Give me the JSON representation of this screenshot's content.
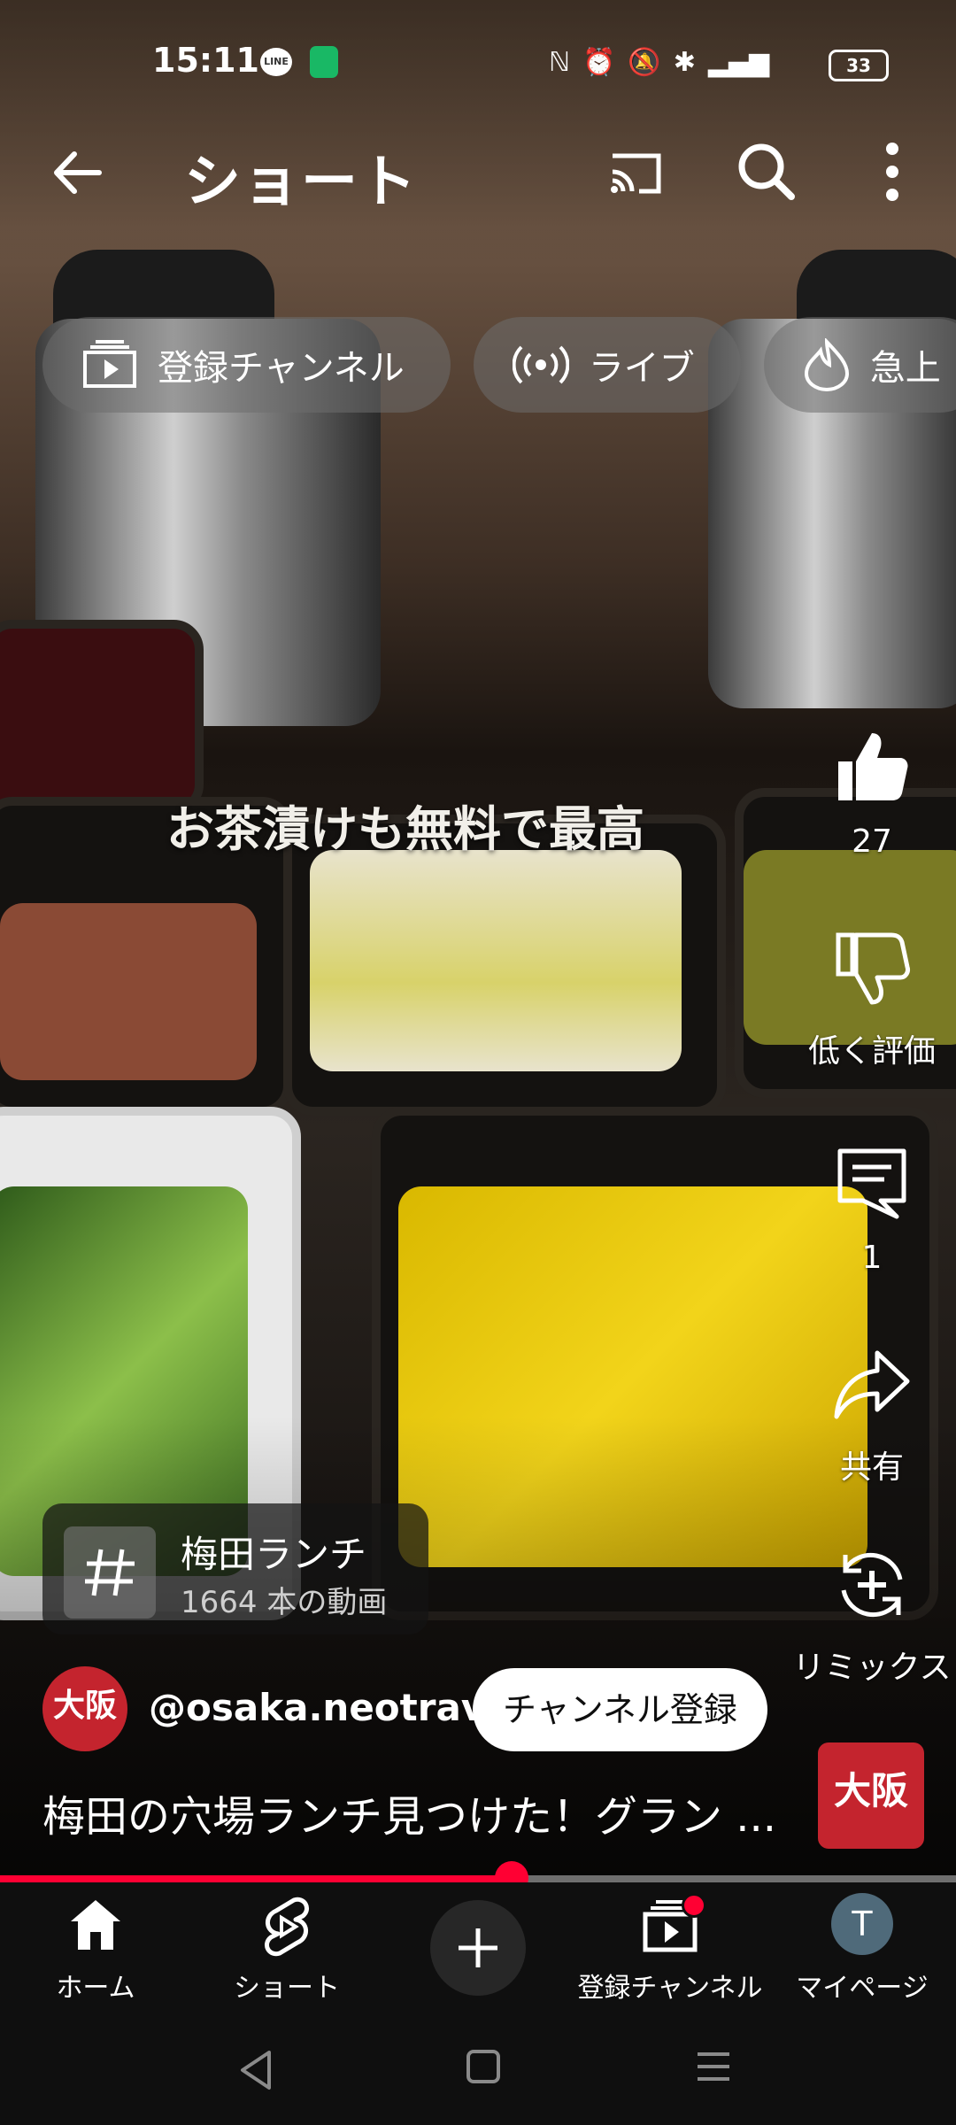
{
  "status_bar": {
    "time": "15:11",
    "battery": "33"
  },
  "app_bar": {
    "title": "ショート"
  },
  "chips": [
    {
      "label": "登録チャンネル",
      "icon": "subscriptions-icon"
    },
    {
      "label": "ライブ",
      "icon": "live-icon"
    },
    {
      "label": "急上",
      "icon": "trending-icon"
    }
  ],
  "video": {
    "caption": "お茶漬けも無料で最高",
    "progress_fraction": 0.535
  },
  "actions": {
    "like_count": "27",
    "dislike_label": "低く評価",
    "comment_count": "1",
    "share_label": "共有",
    "remix_label": "リミックス"
  },
  "hashtag": {
    "title": "梅田ランチ",
    "subtitle": "1664 本の動画"
  },
  "channel": {
    "avatar_text": "大阪",
    "handle": "@osaka.neotravel",
    "subscribe_label": "チャンネル登録"
  },
  "video_title": "梅田の穴場ランチ見つけた！グラン ...",
  "bottom_nav": {
    "home": "ホーム",
    "shorts": "ショート",
    "subscriptions": "登録チャンネル",
    "account": "マイページ",
    "account_initial": "T"
  },
  "colors": {
    "accent": "#ff0033",
    "background": "#0f0f0f",
    "brand_red": "#c4242e"
  }
}
